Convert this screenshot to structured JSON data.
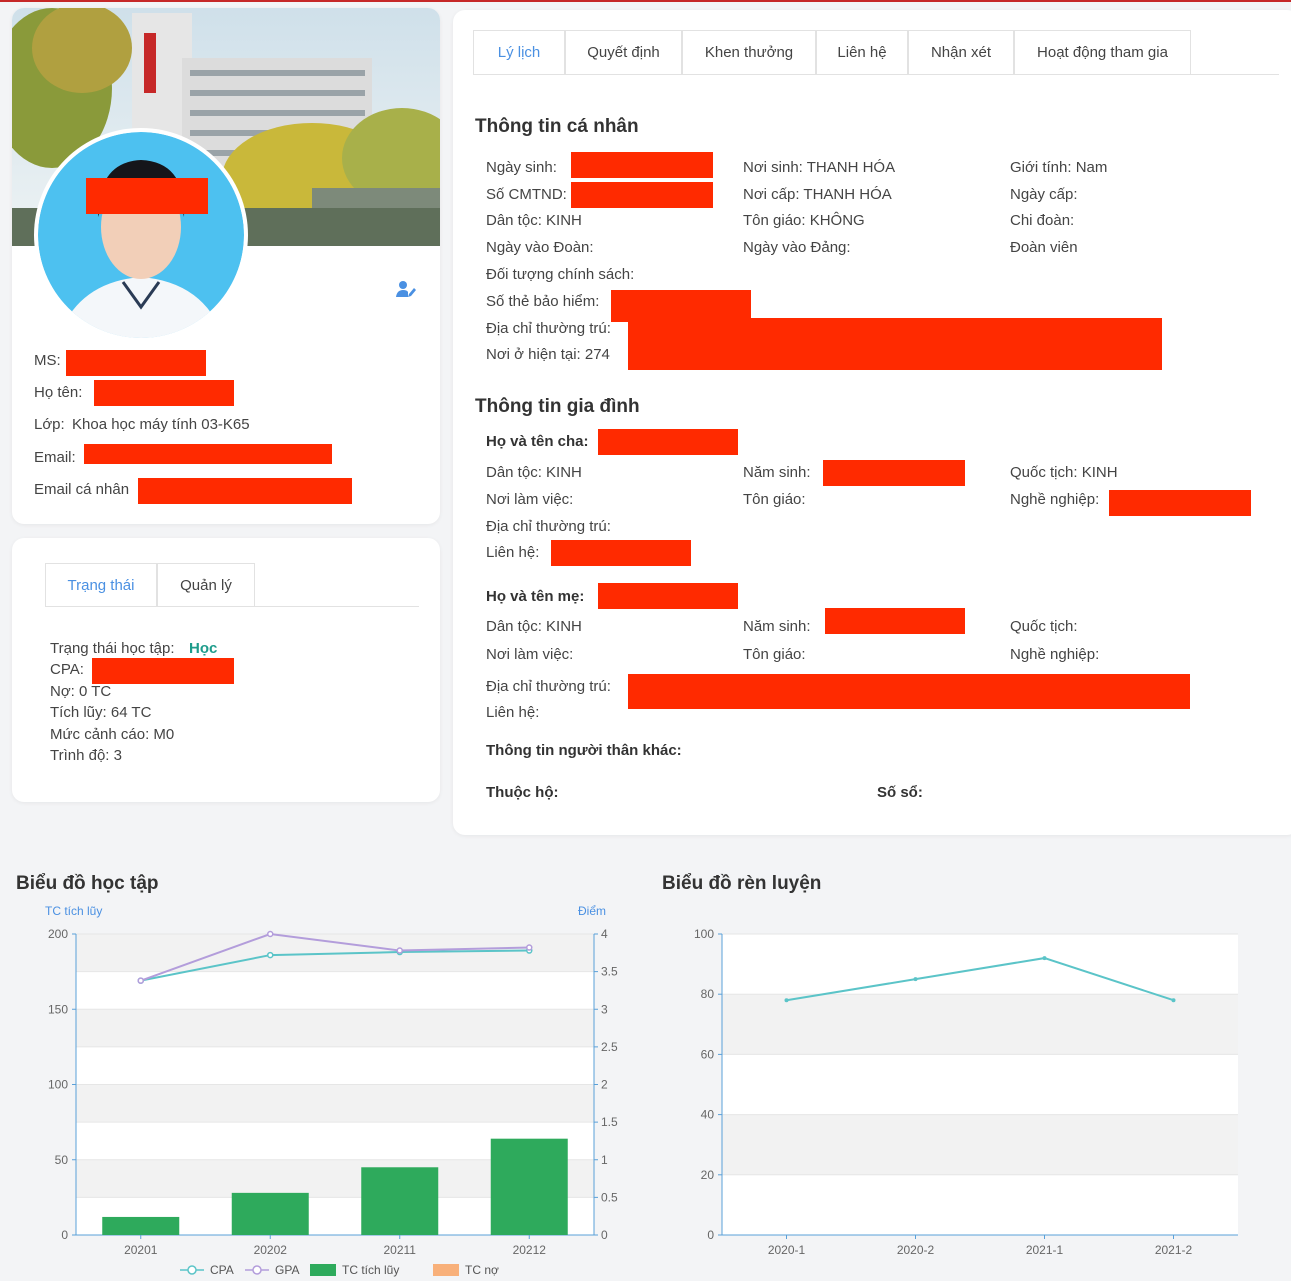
{
  "profile": {
    "ms_label": "MS:",
    "name_label": "Họ tên:",
    "class_label": "Lớp:",
    "class_value": "Khoa học máy tính 03-K65",
    "email_label": "Email:",
    "personal_email_label": "Email cá nhân"
  },
  "status": {
    "tabs": [
      "Trạng thái",
      "Quản lý"
    ],
    "status_label": "Trạng thái học tập:",
    "status_value": "Học",
    "cpa_label": "CPA:",
    "debt": "Nợ: 0 TC",
    "accumulated": "Tích lũy: 64 TC",
    "warning": "Mức cảnh cáo: M0",
    "level": "Trình độ: 3"
  },
  "tabs": [
    "Lý lịch",
    "Quyết định",
    "Khen thưởng",
    "Liên hệ",
    "Nhận xét",
    "Hoạt động tham gia"
  ],
  "personal": {
    "title": "Thông tin cá nhân",
    "dob": "Ngày sinh:",
    "cmnd": "Số CMTND:",
    "ethnic": "Dân tộc: KINH",
    "union_date": "Ngày vào Đoàn:",
    "policy": "Đối tượng chính sách:",
    "insurance": "Số thẻ bảo hiểm:",
    "permanent": "Địa chỉ thường trú:",
    "current": "Nơi ở hiện tại: 274",
    "birthplace": "Nơi sinh: THANH HÓA",
    "issue_place": "Nơi cấp: THANH HÓA",
    "religion": "Tôn giáo: KHÔNG",
    "party_date": "Ngày vào Đảng:",
    "gender": "Giới tính: Nam",
    "issue_date": "Ngày cấp:",
    "branch": "Chi đoàn:",
    "member": "Đoàn viên"
  },
  "family": {
    "title": "Thông tin gia đình",
    "father_label": "Họ và tên cha:",
    "f_ethnic": "Dân tộc: KINH",
    "f_work": "Nơi làm việc:",
    "f_address": "Địa chỉ thường trú:",
    "f_contact": "Liên hệ:",
    "f_birth": "Năm sinh:",
    "f_religion": "Tôn giáo:",
    "f_nation": "Quốc tịch: KINH",
    "f_job": "Nghề nghiệp:",
    "mother_label": "Họ và tên mẹ:",
    "m_ethnic": "Dân tộc: KINH",
    "m_work": "Nơi làm việc:",
    "m_address": "Địa chỉ thường trú:",
    "m_contact": "Liên hệ:",
    "m_birth": "Năm sinh:",
    "m_religion": "Tôn giáo:",
    "m_nation": "Quốc tịch:",
    "m_job": "Nghề nghiệp:",
    "other": "Thông tin người thân khác:",
    "household": "Thuộc hộ:",
    "book": "Số sổ:"
  },
  "chart_data": [
    {
      "type": "bar",
      "title": "Biểu đồ học tập",
      "ylabel": "TC tích lũy",
      "y2label": "Điểm",
      "categories": [
        "20201",
        "20202",
        "20211",
        "20212"
      ],
      "ylim": [
        0,
        200
      ],
      "y2lim": [
        0,
        4
      ],
      "yticks": [
        0,
        50,
        100,
        150,
        200
      ],
      "y2ticks": [
        0,
        0.5,
        1,
        1.5,
        2,
        2.5,
        3,
        3.5,
        4
      ],
      "series": [
        {
          "name": "CPA",
          "kind": "line",
          "axis": "y2",
          "color": "#5bc4c8",
          "values": [
            3.38,
            3.72,
            3.76,
            3.78
          ]
        },
        {
          "name": "GPA",
          "kind": "line",
          "axis": "y2",
          "color": "#b39ddb",
          "values": [
            3.38,
            4.0,
            3.78,
            3.82
          ]
        },
        {
          "name": "TC tích lũy",
          "kind": "bar",
          "axis": "y",
          "color": "#2eaa5c",
          "values": [
            12,
            28,
            45,
            64
          ]
        },
        {
          "name": "TC nợ",
          "kind": "bar",
          "axis": "y",
          "color": "#f8b07a",
          "values": [
            0,
            0,
            0,
            0
          ]
        }
      ],
      "legend": "bottom",
      "grid": true
    },
    {
      "type": "line",
      "title": "Biểu đồ rèn luyện",
      "categories": [
        "2020-1",
        "2020-2",
        "2021-1",
        "2021-2"
      ],
      "ylim": [
        0,
        100
      ],
      "yticks": [
        0,
        20,
        40,
        60,
        80,
        100
      ],
      "series": [
        {
          "kind": "line",
          "color": "#5bc4c8",
          "values": [
            78,
            85,
            92,
            78
          ]
        }
      ],
      "grid": true
    }
  ],
  "colors": {
    "accent": "#4a90e2",
    "redact": "#ff2a00",
    "status_green": "#1e9c8b"
  },
  "icons": {
    "edit_user": "user-edit-icon"
  }
}
